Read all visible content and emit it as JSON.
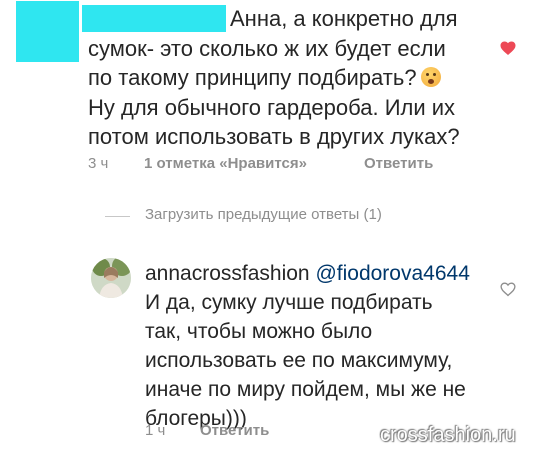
{
  "comment": {
    "lines": [
      "Анна, а конкретно для",
      "сумок- это сколько ж их будет если",
      "по такому принципу подбирать?",
      "Ну для обычного гардероба. Или их",
      "потом использовать в других луках?"
    ],
    "emoji_icon": "slightly-frowning-face-emoji",
    "like_icon": "heart-filled-icon",
    "like_color": "#ed4956",
    "time": "3 ч",
    "likes": "1 отметка «Нравится»",
    "reply_label": "Ответить"
  },
  "load_previous": "Загрузить предыдущие ответы (1)",
  "reply": {
    "username": "annacrossfashion",
    "mention": "@fiodorova4644",
    "mention_color": "#00376b",
    "text_lines": [
      "И да, сумку лучше подбирать",
      "так, чтобы можно было",
      "использовать ее по максимуму,",
      "иначе по миру пойдем, мы же не",
      "блогеры)))"
    ],
    "like_icon": "heart-outline-icon",
    "time": "1 ч",
    "reply_label": "Ответить"
  },
  "watermark": "crossfashion.ru"
}
